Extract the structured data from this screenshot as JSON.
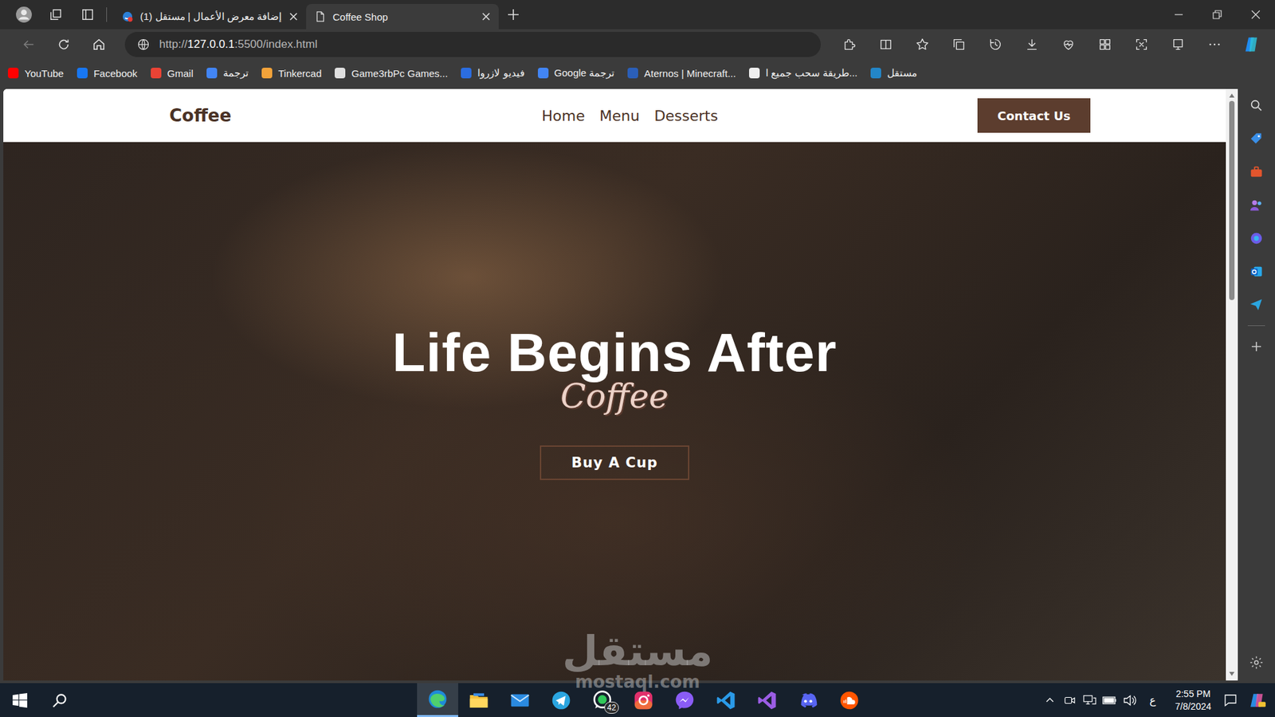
{
  "browser": {
    "tabs": [
      {
        "label": "(1) إضافة معرض الأعمال | مستقل",
        "selected": false
      },
      {
        "label": "Coffee Shop",
        "selected": true
      }
    ],
    "navigation": {
      "back_disabled": true
    },
    "address": {
      "scheme": "http://",
      "host": "127.0.0.1",
      "path": ":5500/index.html"
    },
    "bookmarks": [
      {
        "label": "YouTube",
        "color": "#ff0000"
      },
      {
        "label": "Facebook",
        "color": "#1877f2"
      },
      {
        "label": "Gmail",
        "color": "#ea4335"
      },
      {
        "label": "ترجمة",
        "color": "#4285f4"
      },
      {
        "label": "Tinkercad",
        "color": "#f2a33a"
      },
      {
        "label": "Game3rbPc Games...",
        "color": "#e0e0e0"
      },
      {
        "label": "فيديو لازروا",
        "color": "#2b6de0"
      },
      {
        "label": "Google ترجمة",
        "color": "#4285f4"
      },
      {
        "label": "Aternos | Minecraft...",
        "color": "#2b5fb8"
      },
      {
        "label": "طريقة سحب جميع ا...",
        "color": "#eeeeee"
      },
      {
        "label": "مستقل",
        "color": "#2386c8"
      }
    ]
  },
  "page": {
    "logo": "Coffee",
    "nav": [
      {
        "label": "Home"
      },
      {
        "label": "Menu"
      },
      {
        "label": "Desserts"
      }
    ],
    "cta": "Contact Us",
    "hero": {
      "title": "Life Begins After",
      "accent": "Coffee",
      "button": "Buy A Cup"
    }
  },
  "watermark": {
    "arabic": "مستقل",
    "latin": "mostaql.com"
  },
  "taskbar": {
    "apps": [
      {
        "kind": "edge",
        "selected": true
      },
      {
        "kind": "explorer",
        "selected": false
      },
      {
        "kind": "mail",
        "selected": false
      },
      {
        "kind": "telegram",
        "selected": false
      },
      {
        "kind": "whatsapp",
        "selected": false,
        "badge": "42"
      },
      {
        "kind": "instagram",
        "selected": false
      },
      {
        "kind": "messenger",
        "selected": false
      },
      {
        "kind": "vscode",
        "selected": false
      },
      {
        "kind": "visualstudio",
        "selected": false
      },
      {
        "kind": "discord",
        "selected": false
      },
      {
        "kind": "soundcloud",
        "selected": false
      }
    ],
    "language": "ع",
    "time": "2:55 PM",
    "date": "7/8/2024"
  }
}
